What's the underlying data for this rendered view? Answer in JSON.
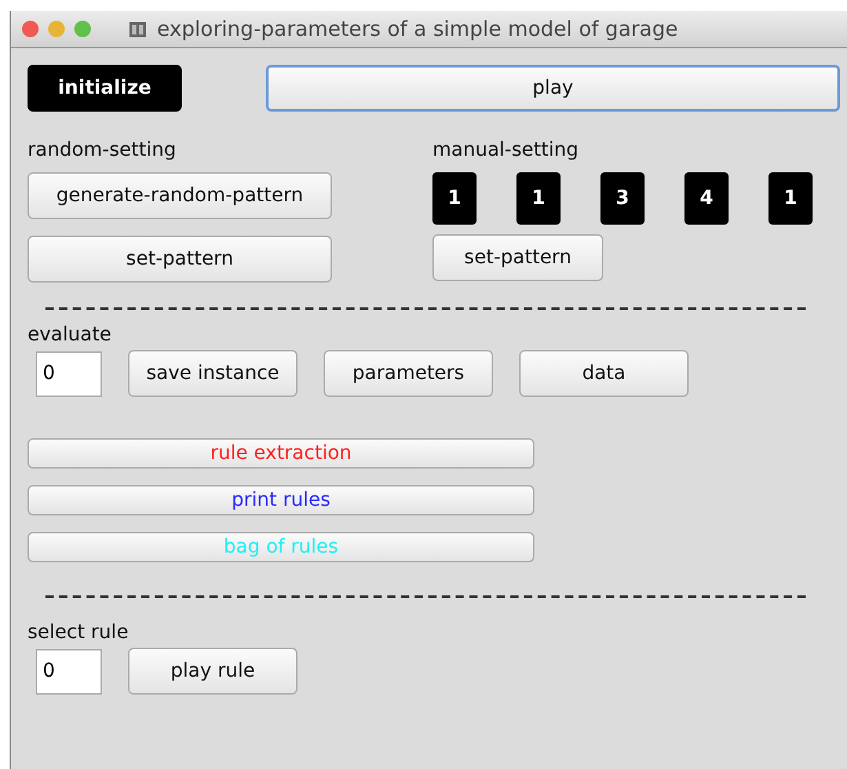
{
  "window": {
    "title": "exploring-parameters of a simple model of garage"
  },
  "top_buttons": [
    {
      "label": "initialize",
      "kind": "dark",
      "focused": false
    },
    {
      "label": "play",
      "kind": "normal",
      "focused": true
    }
  ],
  "random_setting": {
    "label": "random-setting",
    "buttons": [
      "generate-random-pattern",
      "set-pattern"
    ]
  },
  "manual_setting": {
    "label": "manual-setting",
    "values": [
      "1",
      "1",
      "3",
      "4",
      "1"
    ],
    "button": "set-pattern"
  },
  "evaluate": {
    "label": "evaluate",
    "value": "0",
    "buttons": [
      "save instance",
      "parameters",
      "data"
    ]
  },
  "rule_buttons": [
    {
      "label": "rule extraction",
      "color": "#ff2020"
    },
    {
      "label": "print rules",
      "color": "#2a2aff"
    },
    {
      "label": "bag of rules",
      "color": "#20f0f0"
    }
  ],
  "select_rule": {
    "label": "select rule",
    "value": "0",
    "button": "play rule"
  }
}
